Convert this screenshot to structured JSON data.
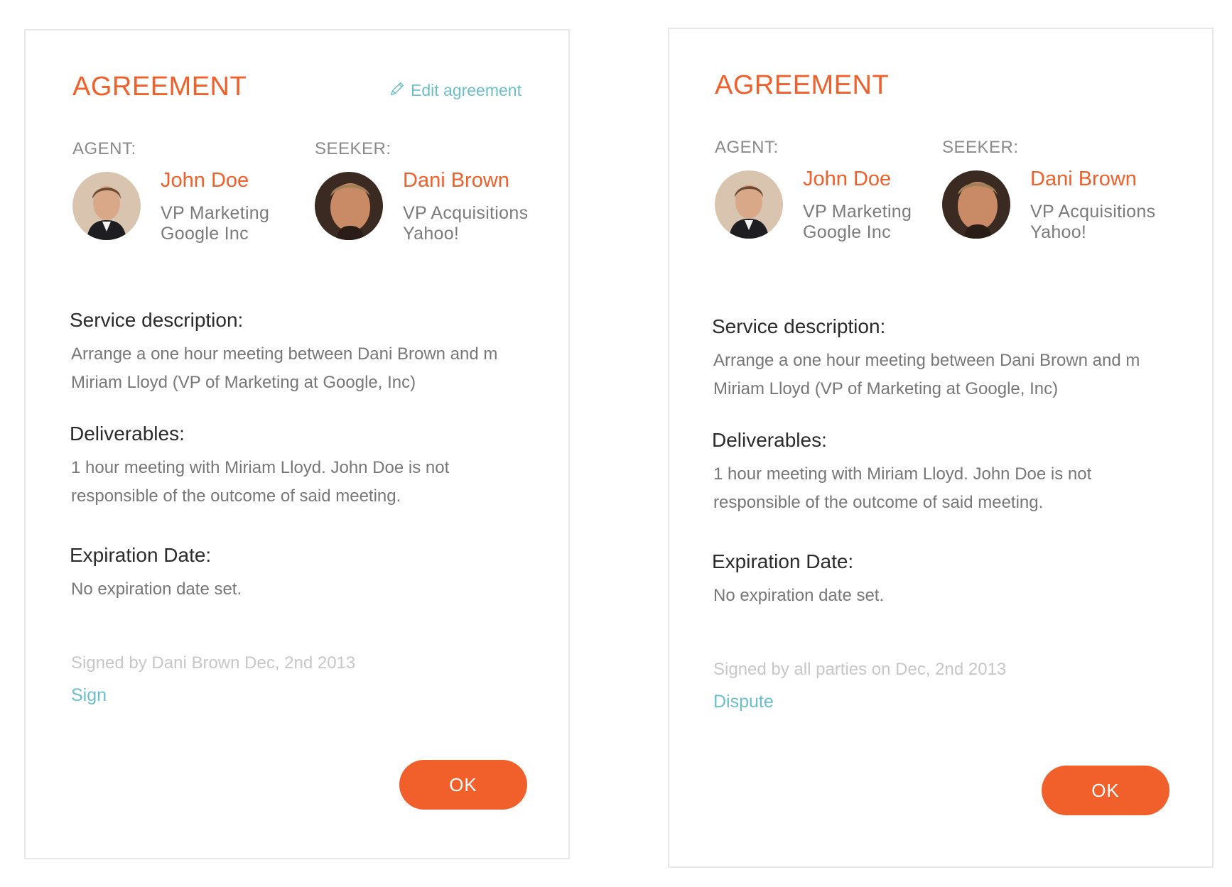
{
  "colors": {
    "accent": "#f1602a",
    "link": "#6bbfcb",
    "muted_text": "#777777",
    "signed_text": "#c7c7c7",
    "card_border": "#e8e8e8"
  },
  "cards": [
    {
      "title": "AGREEMENT",
      "edit_link": {
        "icon": "pencil-icon",
        "label": "Edit agreement"
      },
      "agent": {
        "role": "AGENT:",
        "name": "John Doe",
        "position": "VP Marketing",
        "company": "Google Inc",
        "avatar": "avatar-photo"
      },
      "seeker": {
        "role": "SEEKER:",
        "name": "Dani Brown",
        "position": "VP Acquisitions",
        "company": "Yahoo!",
        "avatar": "avatar-photo"
      },
      "service": {
        "heading": "Service description:",
        "line1": "Arrange a one hour meeting between Dani Brown and m",
        "line2": "Miriam Lloyd (VP of Marketing at Google, Inc)"
      },
      "deliverables": {
        "heading": "Deliverables:",
        "line1": "1 hour meeting with Miriam Lloyd. John Doe is not",
        "line2": "responsible of the outcome of said meeting."
      },
      "expiration": {
        "heading": "Expiration Date:",
        "text": "No expiration date set."
      },
      "signed_text": "Signed by Dani Brown Dec, 2nd 2013",
      "action_link": "Sign",
      "ok_label": "OK"
    },
    {
      "title": "AGREEMENT",
      "agent": {
        "role": "AGENT:",
        "name": "John Doe",
        "position": "VP Marketing",
        "company": "Google Inc",
        "avatar": "avatar-photo"
      },
      "seeker": {
        "role": "SEEKER:",
        "name": "Dani Brown",
        "position": "VP Acquisitions",
        "company": "Yahoo!",
        "avatar": "avatar-photo"
      },
      "service": {
        "heading": "Service description:",
        "line1": "Arrange a one hour meeting between Dani Brown and m",
        "line2": "Miriam Lloyd (VP of Marketing at Google, Inc)"
      },
      "deliverables": {
        "heading": "Deliverables:",
        "line1": "1 hour meeting with Miriam Lloyd. John Doe is not",
        "line2": "responsible of the outcome of said meeting."
      },
      "expiration": {
        "heading": "Expiration Date:",
        "text": "No expiration date set."
      },
      "signed_text": "Signed by all parties on Dec, 2nd 2013",
      "action_link": "Dispute",
      "ok_label": "OK"
    }
  ]
}
